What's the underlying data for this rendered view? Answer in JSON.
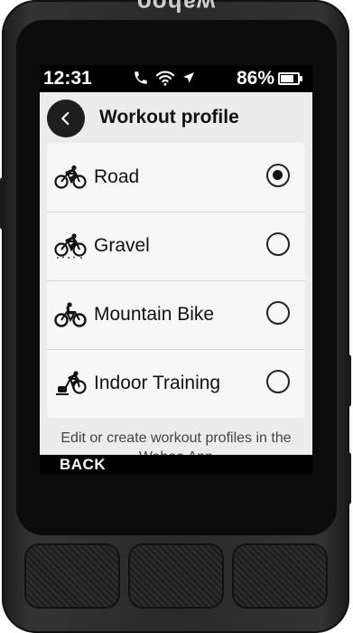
{
  "device": {
    "brand": "wahoo"
  },
  "statusbar": {
    "time": "12:31",
    "battery": "86%",
    "battery_level": 0.86,
    "icons": [
      "phone-icon",
      "wifi-icon",
      "location-arrow-icon",
      "battery-icon"
    ]
  },
  "header": {
    "title": "Workout profile",
    "back_icon": "chevron-left-icon"
  },
  "profiles": [
    {
      "label": "Road",
      "icon": "road-bike-icon",
      "selected": true
    },
    {
      "label": "Gravel",
      "icon": "gravel-bike-icon",
      "selected": false
    },
    {
      "label": "Mountain Bike",
      "icon": "mountain-bike-icon",
      "selected": false
    },
    {
      "label": "Indoor Training",
      "icon": "indoor-trainer-icon",
      "selected": false
    }
  ],
  "footer": {
    "note": "Edit or create workout profiles in the Wahoo App"
  },
  "softkeys": {
    "back_label": "BACK"
  }
}
